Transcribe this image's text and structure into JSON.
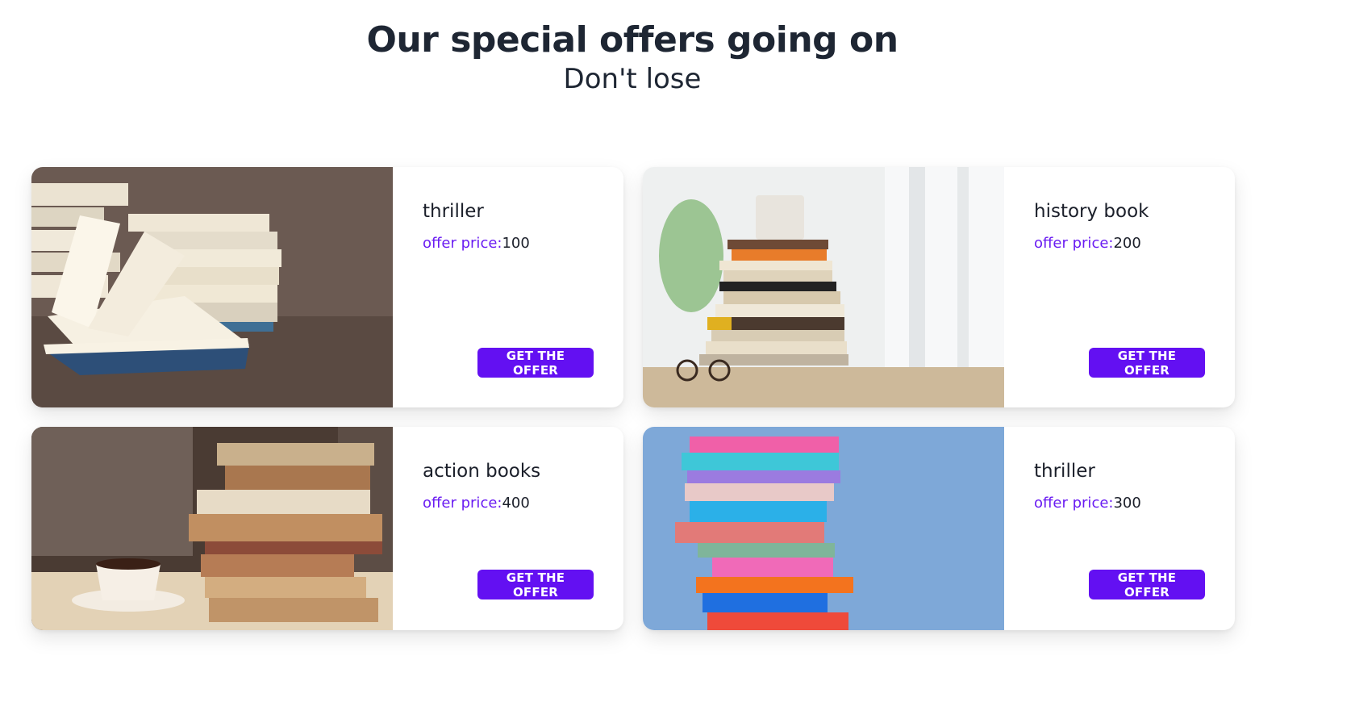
{
  "header": {
    "title": "Our special offers going on",
    "subtitle": "Don't lose"
  },
  "offers": [
    {
      "name": "thriller",
      "price_label": "offer price:",
      "price": "100",
      "button": "GET THE OFFER",
      "image": "open-book-stack-image"
    },
    {
      "name": "history book",
      "price_label": "offer price:",
      "price": "200",
      "button": "GET THE OFFER",
      "image": "book-stack-with-mug-image"
    },
    {
      "name": "action books",
      "price_label": "offer price:",
      "price": "400",
      "button": "GET THE OFFER",
      "image": "book-stack-with-cup-image"
    },
    {
      "name": "thriller",
      "price_label": "offer price:",
      "price": "300",
      "button": "GET THE OFFER",
      "image": "colorful-book-stack-image"
    }
  ],
  "colors": {
    "accent": "#6310f2",
    "price_label": "#6a1cf2",
    "text": "#1e2633"
  }
}
